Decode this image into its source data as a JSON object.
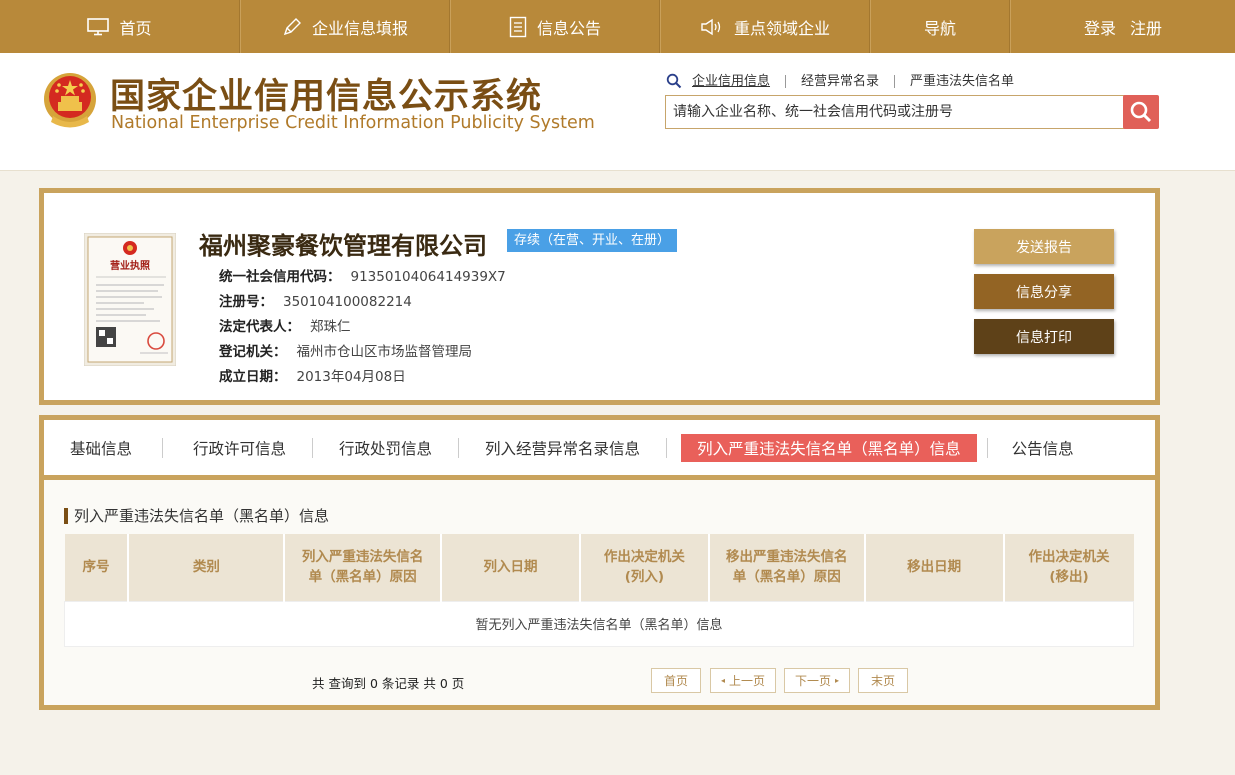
{
  "topnav": {
    "home": "首页",
    "fill": "企业信息填报",
    "notice": "信息公告",
    "key": "重点领域企业",
    "guide": "导航",
    "login": "登录",
    "register": "注册"
  },
  "header": {
    "title_cn": "国家企业信用信息公示系统",
    "title_en": "National Enterprise Credit Information Publicity System",
    "search_tabs": [
      "企业信用信息",
      "经营异常名录",
      "严重违法失信名单"
    ],
    "search_placeholder": "请输入企业名称、统一社会信用代码或注册号"
  },
  "company": {
    "name": "福州聚豪餐饮管理有限公司",
    "status": "存续（在营、开业、在册）",
    "fields": [
      {
        "label": "统一社会信用代码：",
        "value": "9135010406414939X7"
      },
      {
        "label": "注册号：",
        "value": "350104100082214"
      },
      {
        "label": "法定代表人：",
        "value": "郑珠仁"
      },
      {
        "label": "登记机关：",
        "value": "福州市仓山区市场监督管理局"
      },
      {
        "label": "成立日期：",
        "value": "2013年04月08日"
      }
    ],
    "license_label": "营业执照",
    "actions": {
      "send": "发送报告",
      "share": "信息分享",
      "print": "信息打印"
    },
    "colors": {
      "send": "#c9a35d",
      "share": "#936424",
      "print": "#5e4118"
    }
  },
  "tabs": [
    "基础信息",
    "行政许可信息",
    "行政处罚信息",
    "列入经营异常名录信息",
    "列入严重违法失信名单（黑名单）信息",
    "公告信息"
  ],
  "section": {
    "title": "列入严重违法失信名单（黑名单）信息",
    "columns": [
      "序号",
      "类别",
      "列入严重违法失信名单（黑名单）原因",
      "列入日期",
      "作出决定机关(列入)",
      "移出严重违法失信名单（黑名单）原因",
      "移出日期",
      "作出决定机关(移出)"
    ],
    "empty_text": "暂无列入严重违法失信名单（黑名单）信息",
    "summary": "共 查询到 0 条记录 共 0 页",
    "pager": {
      "first": "首页",
      "prev": "上一页",
      "next": "下一页",
      "last": "末页"
    }
  },
  "theme": {
    "nav": "#b8893a",
    "accent": "#c9a35d",
    "active_tab": "#e9605a",
    "status": "#4aa0e6"
  }
}
